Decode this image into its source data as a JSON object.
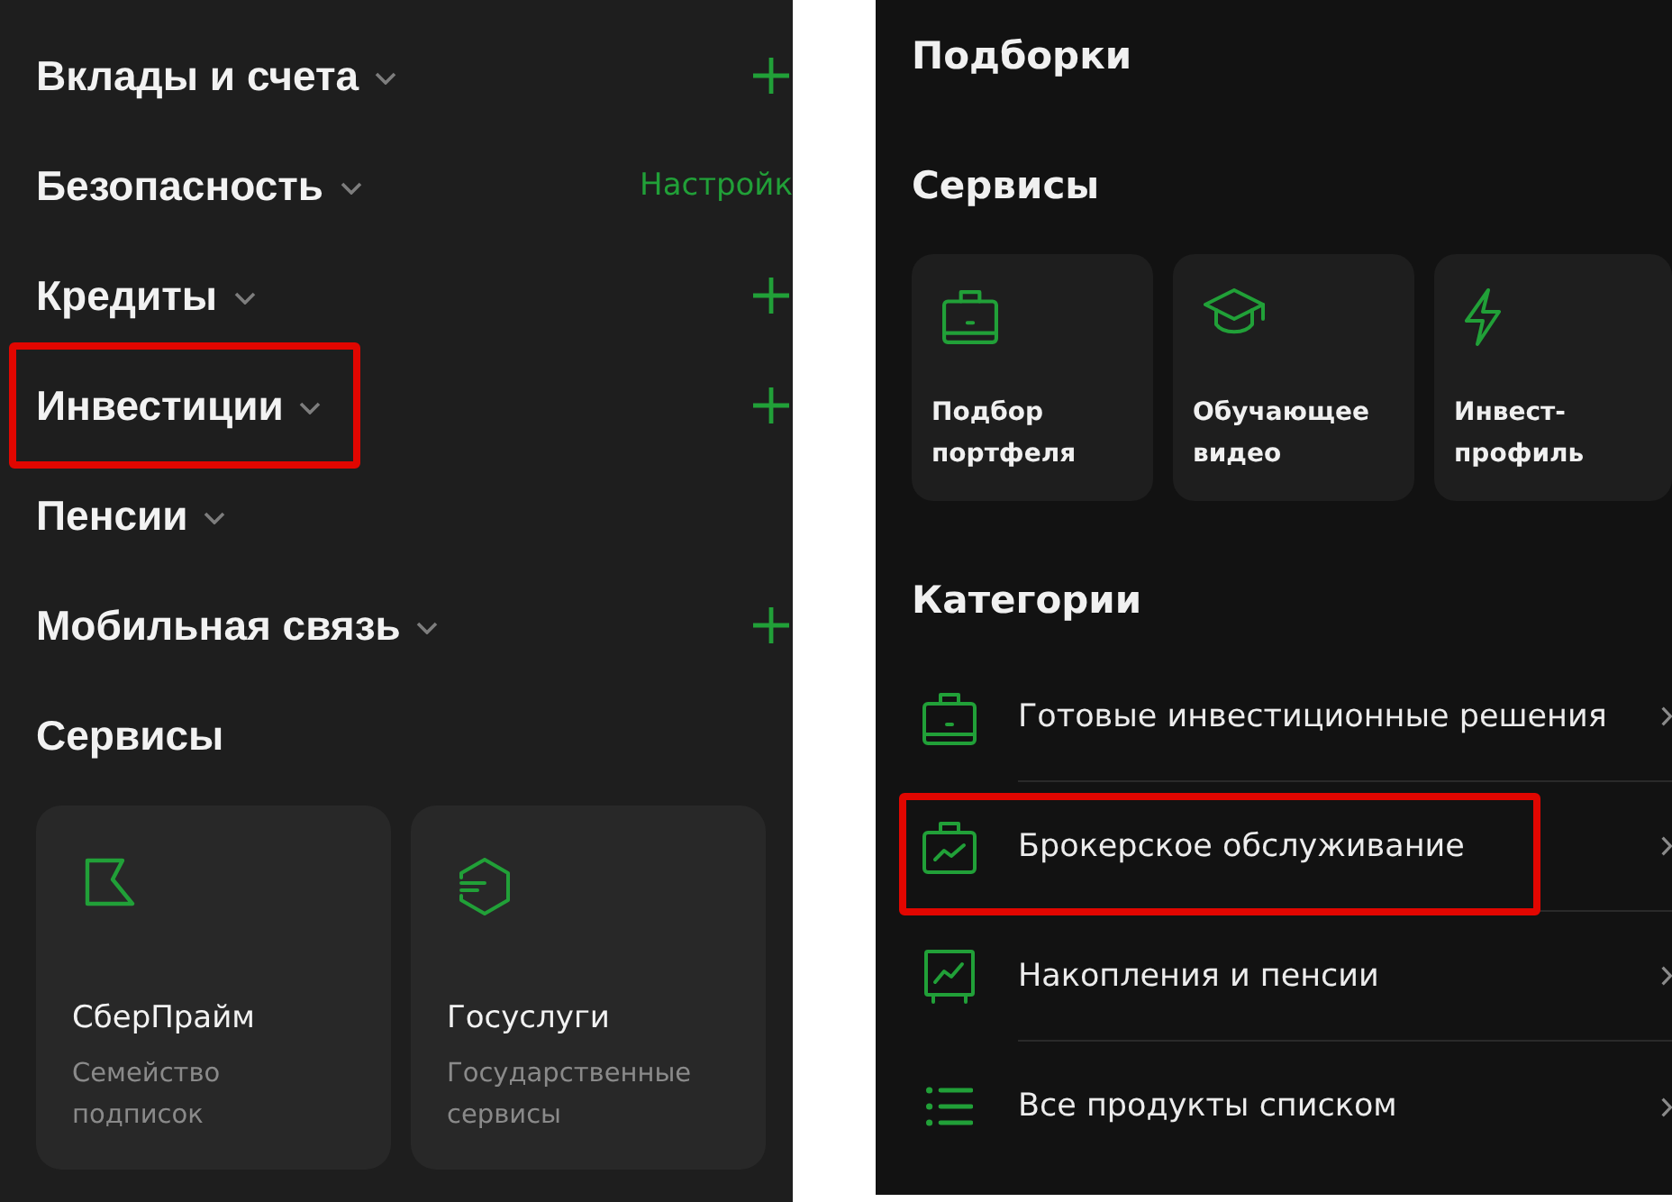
{
  "left_screen": {
    "sections": [
      {
        "label": "Вклады и счета",
        "expanded": false,
        "highlighted": false,
        "action": {
          "kind": "add"
        }
      },
      {
        "label": "Безопасность",
        "expanded": false,
        "highlighted": false,
        "action": {
          "kind": "link",
          "label": "Настройк"
        }
      },
      {
        "label": "Кредиты",
        "expanded": false,
        "highlighted": false,
        "action": {
          "kind": "add"
        }
      },
      {
        "label": "Инвестиции",
        "expanded": false,
        "highlighted": true,
        "action": {
          "kind": "add"
        }
      },
      {
        "label": "Пенсии",
        "expanded": false,
        "highlighted": false
      },
      {
        "label": "Мобильная связь",
        "expanded": false,
        "highlighted": false,
        "action": {
          "kind": "add"
        }
      }
    ],
    "services_title": "Сервисы",
    "services": [
      {
        "kind": "subscription",
        "title": "СберПрайм",
        "subtitle": "Семейство подписок"
      },
      {
        "kind": "gov_services",
        "title": "Госуслуги",
        "subtitle": "Государственные сервисы"
      }
    ]
  },
  "right_screen": {
    "collections_title": "Подборки",
    "services_title": "Сервисы",
    "services": [
      {
        "kind": "portfolio",
        "title": "Подбор портфеля"
      },
      {
        "kind": "education",
        "title": "Обучающее видео"
      },
      {
        "kind": "profile",
        "title": "Инвест-профиль"
      }
    ],
    "categories_title": "Категории",
    "categories": [
      {
        "kind": "ready_solutions",
        "label": "Готовые инвестиционные решения",
        "highlighted": false
      },
      {
        "kind": "brokerage",
        "label": "Брокерское обслуживание",
        "highlighted": true
      },
      {
        "kind": "savings",
        "label": "Накопления и пенсии",
        "highlighted": false
      },
      {
        "kind": "all_products",
        "label": "Все продукты списком",
        "highlighted": false
      }
    ]
  }
}
